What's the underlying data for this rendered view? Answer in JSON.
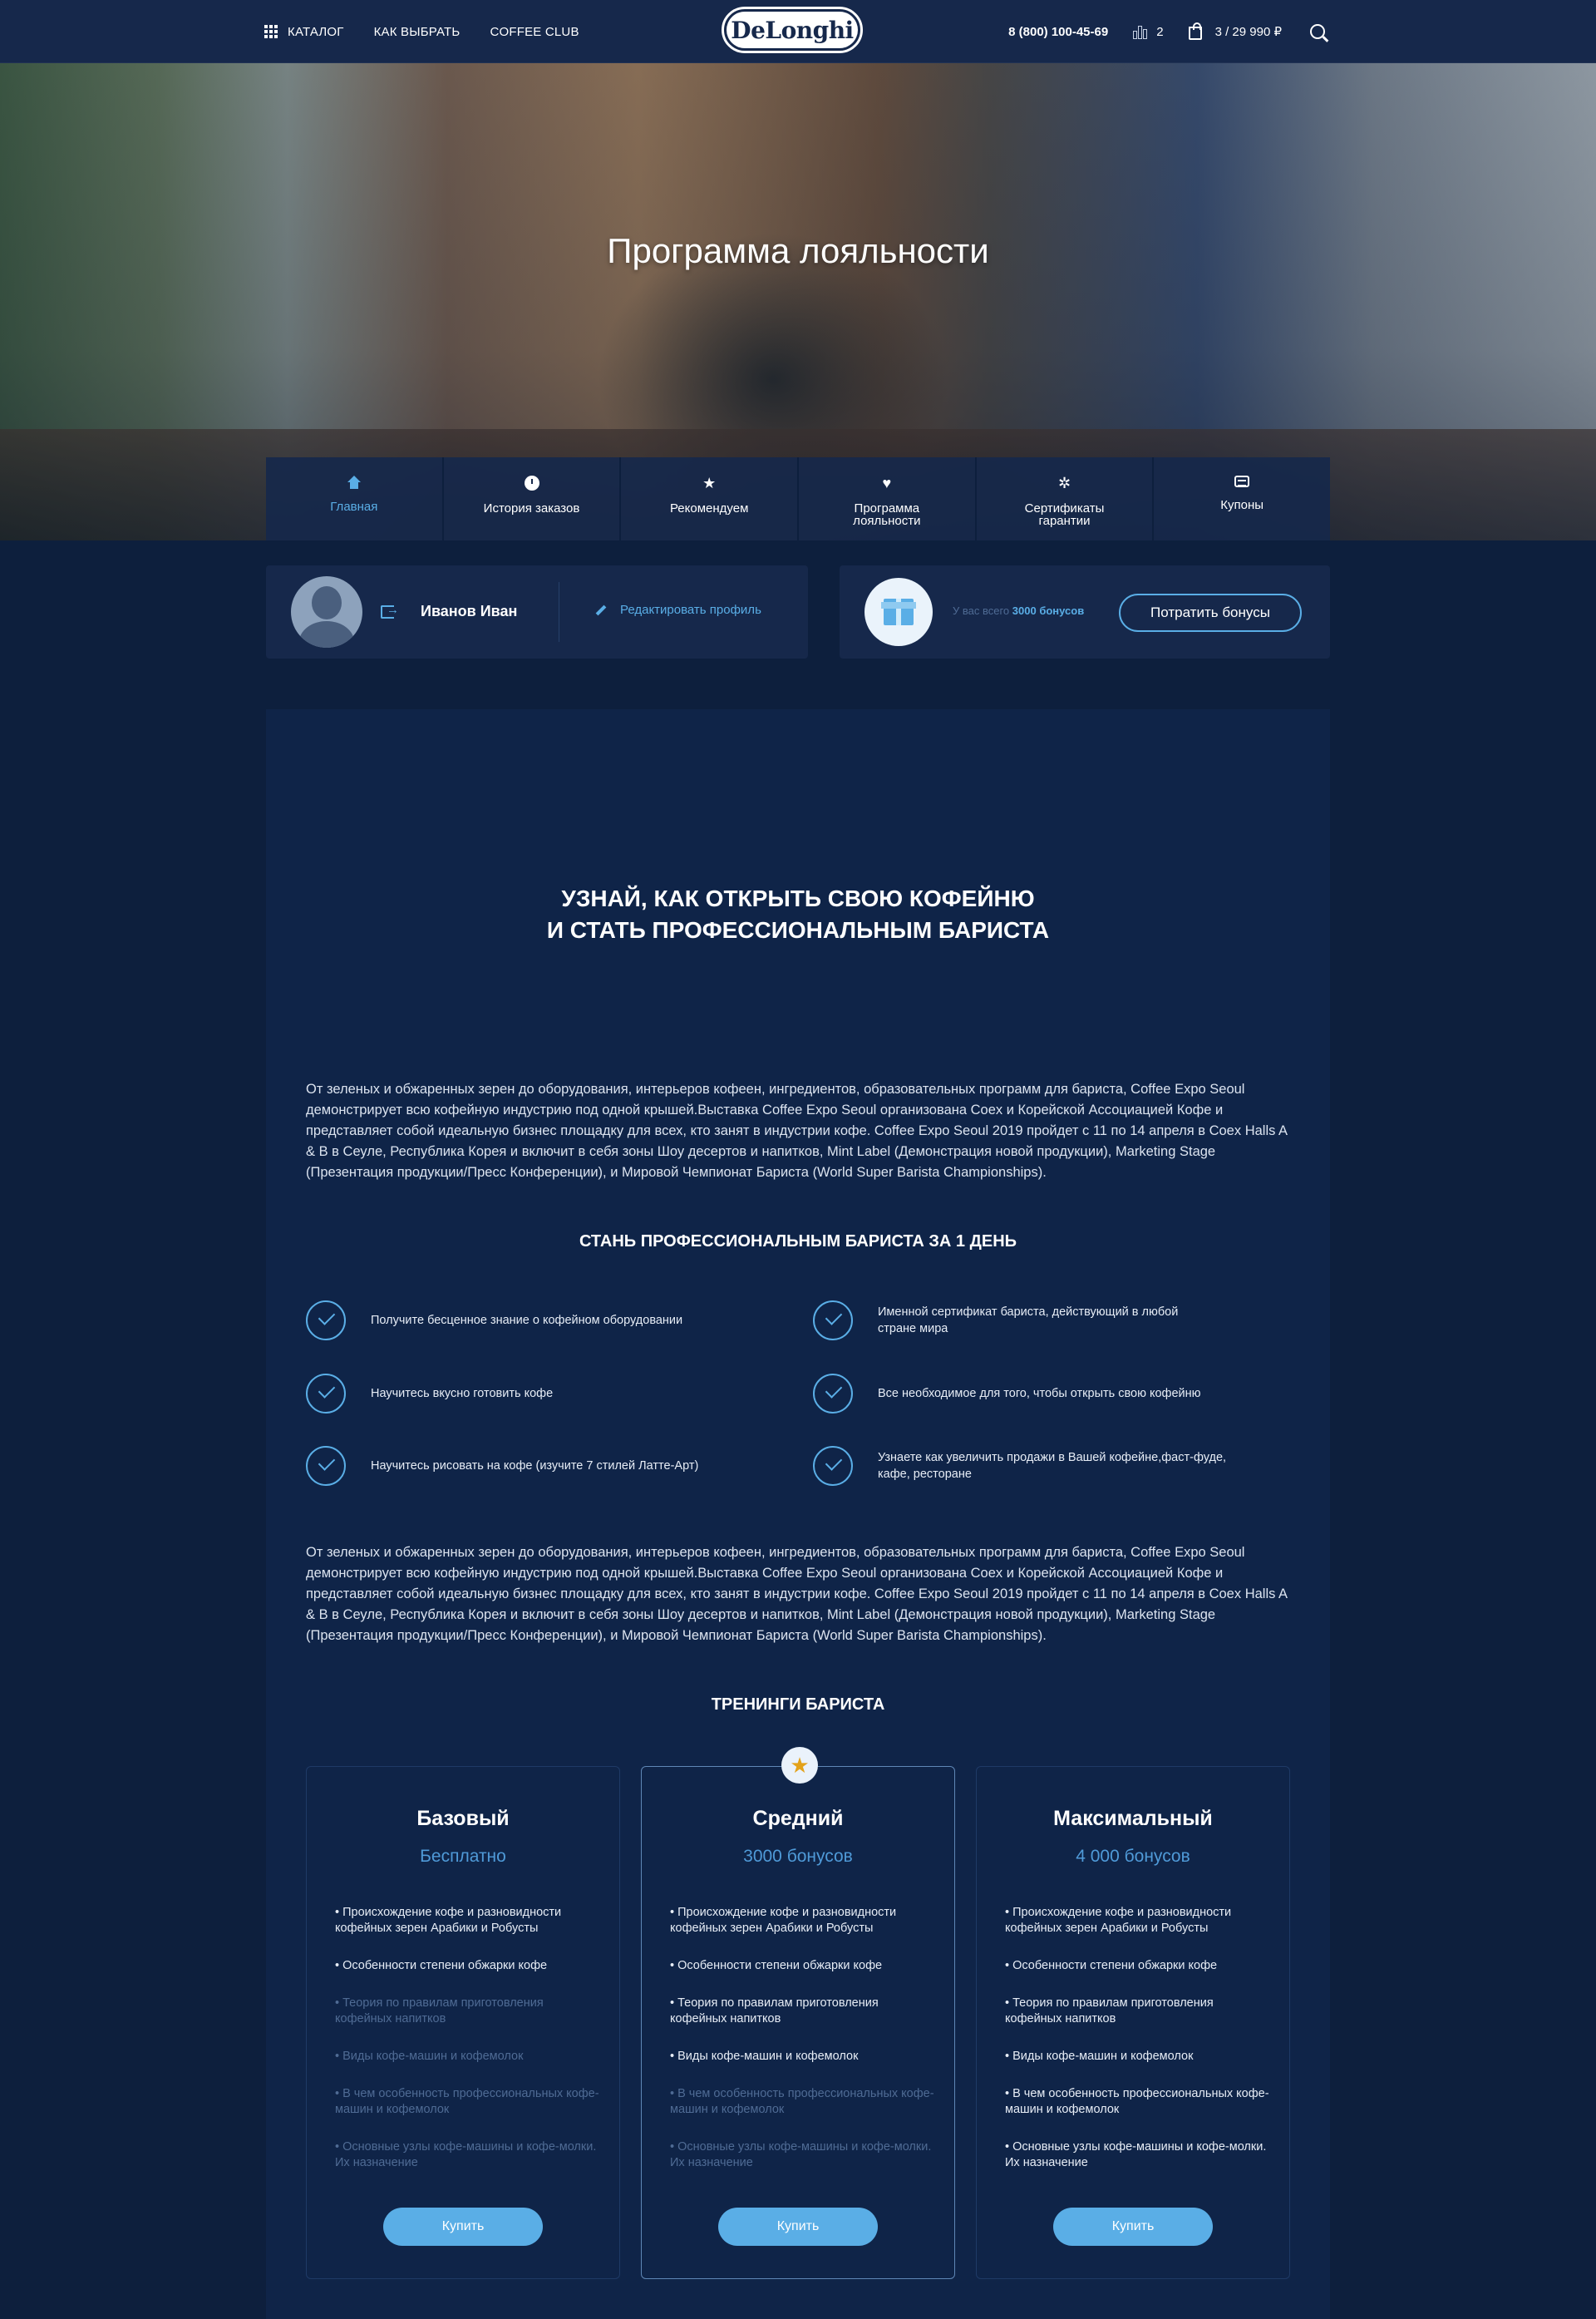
{
  "header": {
    "nav": [
      "КАТАЛОГ",
      "КАК ВЫБРАТЬ",
      "COFFEE CLUB"
    ],
    "logo": "DeLonghi",
    "phone": "8 (800) 100-45-69",
    "compare_count": "2",
    "cart": "3 / 29 990 ₽"
  },
  "hero": {
    "title": "Программа лояльности"
  },
  "tabs": [
    {
      "label": "Главная",
      "icon": "home-icon",
      "active": true
    },
    {
      "label": "История заказов",
      "icon": "clock-icon"
    },
    {
      "label": "Рекомендуем",
      "icon": "star-icon"
    },
    {
      "label": "Программа лояльности",
      "icon": "heart-icon"
    },
    {
      "label": "Сертификаты гарантии",
      "icon": "gear-icon"
    },
    {
      "label": "Купоны",
      "icon": "coupon-icon"
    }
  ],
  "user": {
    "name": "Иванов Иван",
    "edit_label": "Редактировать профиль",
    "bonus_prefix": "У вас всего",
    "bonus_amount": "3000 бонусов",
    "spend_label": "Потратить бонусы"
  },
  "content": {
    "headline_1": "УЗНАЙ, КАК ОТКРЫТЬ СВОЮ КОФЕЙНЮ",
    "headline_2": "И СТАТЬ ПРОФЕССИОНАЛЬНЫМ БАРИСТА",
    "paragraph": "От зеленых и обжаренных зерен до оборудования, интерьеров кофеен, ингредиентов, образовательных программ для бариста, Coffee Expo Seoul демонстрирует всю кофейную индустрию под одной крышей.Выставка Coffee Expo Seoul организована Coex и Корейской Ассоциацией Кофе и представляет собой идеальную бизнес площадку для всех, кто занят в индустрии кофе. Coffee Expo Seoul 2019 пройдет с 11 по 14 апреля в Coex Halls A & B в Сеуле, Республика Корея и включит в себя зоны Шоу десертов и напитков, Mint Label (Демонстрация новой продукции), Marketing Stage (Презентация продукции/Пресс Конференции), и Мировой Чемпионат Бариста (World Super Barista Championships).",
    "benefits_title": "СТАНЬ ПРОФЕССИОНАЛЬНЫМ БАРИСТА ЗА 1 ДЕНЬ",
    "benefits": [
      "Получите бесценное знание о кофейном оборудовании",
      "Именной сертификат бариста, действующий в любой стране мира",
      "Научитесь вкусно готовить кофе",
      "Все необходимое для того, чтобы открыть свою кофейню",
      "Научитесь рисовать на кофе (изучите 7 стилей Латте-Арт)",
      "Узнаете как увеличить продажи в Вашей кофейне,фаст-фуде, кафе, ресторане"
    ],
    "trainings_title": "ТРЕНИНГИ БАРИСТА"
  },
  "plans": [
    {
      "name": "Базовый",
      "price": "Бесплатно",
      "features": [
        "Происхождение кофе и разновидности кофейных зерен Арабики и Робусты",
        "Особенности степени обжарки кофе",
        "Теория по правилам приготовления кофейных напитков",
        "Виды кофе-машин и кофемолок",
        "В чем особенность профессиональных кофе-машин и кофемолок",
        "Основные узлы кофе-машины и кофе-молки. Их назначение"
      ],
      "included_count": 2,
      "button": "Купить"
    },
    {
      "name": "Средний",
      "price": "3000 бонусов",
      "featured": true,
      "features": [
        "Происхождение кофе и разновидности кофейных зерен Арабики и Робусты",
        "Особенности степени обжарки кофе",
        "Теория по правилам приготовления кофейных напитков",
        "Виды кофе-машин и кофемолок",
        "В чем особенность профессиональных кофе-машин и кофемолок",
        "Основные узлы кофе-машины и кофе-молки. Их назначение"
      ],
      "included_count": 4,
      "button": "Купить"
    },
    {
      "name": "Максимальный",
      "price": "4 000 бонусов",
      "features": [
        "Происхождение кофе и разновидности кофейных зерен Арабики и Робусты",
        "Особенности степени обжарки кофе",
        "Теория по правилам приготовления кофейных напитков",
        "Виды кофе-машин и кофемолок",
        "В чем особенность профессиональных кофе-машин и кофемолок",
        "Основные узлы кофе-машины и кофе-молки. Их назначение"
      ],
      "included_count": 6,
      "button": "Купить"
    }
  ],
  "colors": {
    "background": "#0d1f3d",
    "panel": "#0f2448",
    "header": "#16284b",
    "accent": "#5aaee6"
  }
}
